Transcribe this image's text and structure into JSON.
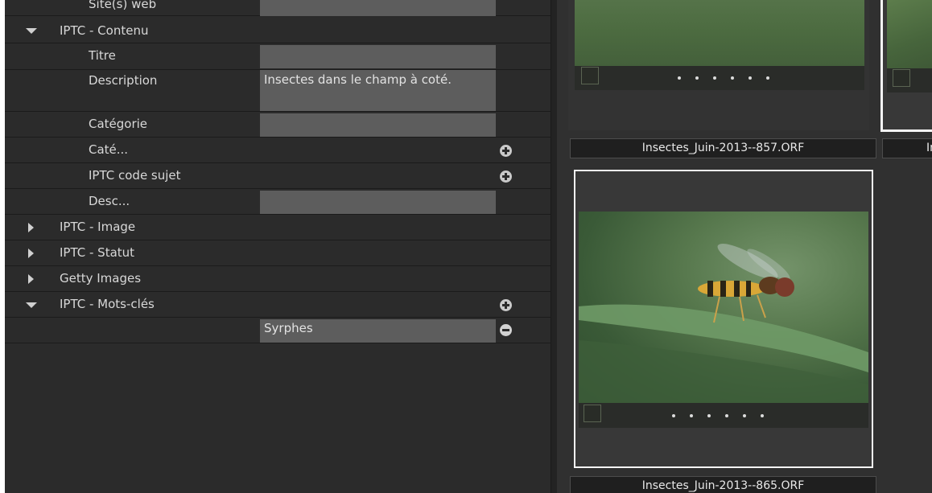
{
  "metadata": {
    "partial_row": {
      "label": "Site(s) web"
    },
    "sections": {
      "contenu": {
        "label": "IPTC - Contenu"
      },
      "image": {
        "label": "IPTC - Image"
      },
      "statut": {
        "label": "IPTC - Statut"
      },
      "getty": {
        "label": "Getty Images"
      },
      "mots_cles": {
        "label": "IPTC - Mots-clés"
      }
    },
    "fields": {
      "titre": {
        "label": "Titre",
        "value": ""
      },
      "description": {
        "label": "Description",
        "value": "Insectes dans le champ à coté."
      },
      "categorie": {
        "label": "Catégorie",
        "value": ""
      },
      "cate_suppl": {
        "label": "Caté..."
      },
      "code_sujet": {
        "label": "IPTC code sujet"
      },
      "desc": {
        "label": "Desc...",
        "value": ""
      }
    },
    "keywords": [
      {
        "value": "Syrphes"
      }
    ]
  },
  "thumbnails": [
    {
      "filename": "Insectes_Juin-2013--857.ORF",
      "selected": false
    },
    {
      "filename": "Ins",
      "selected": true
    },
    {
      "filename": "Insectes_Juin-2013--865.ORF",
      "selected": true
    }
  ],
  "icons": {
    "expanded": "triangle-down-icon",
    "collapsed": "triangle-right-icon",
    "add": "plus-circle-icon",
    "remove": "minus-circle-icon"
  },
  "colors": {
    "panel_bg": "#2b2b2b",
    "field_bg": "#5d5d5d",
    "text": "#d8d8d8",
    "selection_border": "#f5f5f5"
  }
}
